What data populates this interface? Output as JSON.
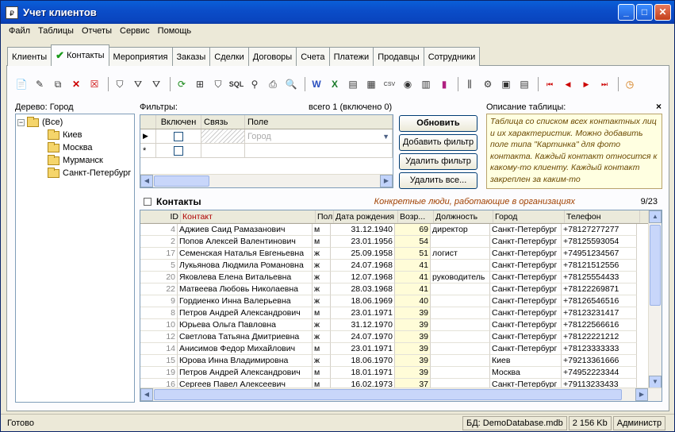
{
  "window": {
    "title": "Учет клиентов",
    "app_icon": "ledger-icon",
    "minimize": "_",
    "maximize": "□",
    "close": "✕"
  },
  "menu": [
    "Файл",
    "Таблицы",
    "Отчеты",
    "Сервис",
    "Помощь"
  ],
  "tabs": [
    {
      "label": "Клиенты"
    },
    {
      "label": "Контакты",
      "active": true
    },
    {
      "label": "Мероприятия"
    },
    {
      "label": "Заказы"
    },
    {
      "label": "Сделки"
    },
    {
      "label": "Договоры"
    },
    {
      "label": "Счета"
    },
    {
      "label": "Платежи"
    },
    {
      "label": "Продавцы"
    },
    {
      "label": "Сотрудники"
    }
  ],
  "tree": {
    "label": "Дерево: Город",
    "root": "(Все)",
    "items": [
      "Киев",
      "Москва",
      "Мурманск",
      "Санкт-Петербург"
    ]
  },
  "filters": {
    "label": "Фильтры:",
    "total": "всего 1 (включено 0)",
    "columns": [
      "Включен",
      "Связь",
      "Поле"
    ],
    "row_placeholder": "Город",
    "new_row_marker": "*"
  },
  "buttons": {
    "refresh": "Обновить",
    "add_filter": "Добавить фильтр",
    "remove_filter": "Удалить фильтр",
    "remove_all": "Удалить все..."
  },
  "description": {
    "label": "Описание таблицы:",
    "close": "×",
    "text": "Таблица со списком всех контактных лиц и их характеристик. Можно добавить поле типа \"Картинка\" для фото контакта. Каждый контакт относится к какому-то клиенту. Каждый контакт закреплен за каким-то"
  },
  "grid": {
    "title": "Контакты",
    "subtitle": "Конкретные люди, работающие в организациях",
    "counter": "9/23",
    "columns": [
      "ID",
      "Контакт",
      "Пол",
      "Дата рождения",
      "Возр...",
      "Должность",
      "Город",
      "Телефон"
    ],
    "rows": [
      [
        "4",
        "Аджиев Саид Рамазанович",
        "м",
        "31.12.1940",
        "69",
        "директор",
        "Санкт-Петербург",
        "+78127277277"
      ],
      [
        "2",
        "Попов Алексей Валентинович",
        "м",
        "23.01.1956",
        "54",
        "",
        "Санкт-Петербург",
        "+78125593054"
      ],
      [
        "17",
        "Семенская Наталья Евгеньевна",
        "ж",
        "25.09.1958",
        "51",
        "логист",
        "Санкт-Петербург",
        "+74951234567"
      ],
      [
        "5",
        "Лукьянова Людмила Романовна",
        "ж",
        "24.07.1968",
        "41",
        "",
        "Санкт-Петербург",
        "+78121512556"
      ],
      [
        "20",
        "Яковлева Елена Витальевна",
        "ж",
        "12.07.1968",
        "41",
        "руководитель",
        "Санкт-Петербург",
        "+78125554433"
      ],
      [
        "22",
        "Матвеева Любовь Николаевна",
        "ж",
        "28.03.1968",
        "41",
        "",
        "Санкт-Петербург",
        "+78122269871"
      ],
      [
        "9",
        "Гордиенко Инна Валерьевна",
        "ж",
        "18.06.1969",
        "40",
        "",
        "Санкт-Петербург",
        "+78126546516"
      ],
      [
        "8",
        "Петров Андрей Александрович",
        "м",
        "23.01.1971",
        "39",
        "",
        "Санкт-Петербург",
        "+78123231417"
      ],
      [
        "10",
        "Юрьева Ольга Павловна",
        "ж",
        "31.12.1970",
        "39",
        "",
        "Санкт-Петербург",
        "+78122566616"
      ],
      [
        "12",
        "Светлова Татьяна Дмитриевна",
        "ж",
        "24.07.1970",
        "39",
        "",
        "Санкт-Петербург",
        "+78122221212"
      ],
      [
        "14",
        "Анисимов Федор Михайлович",
        "м",
        "23.01.1971",
        "39",
        "",
        "Санкт-Петербург",
        "+78123333333"
      ],
      [
        "15",
        "Юрова Инна Владимировна",
        "ж",
        "18.06.1970",
        "39",
        "",
        "Киев",
        "+79213361666"
      ],
      [
        "19",
        "Петров Андрей Александрович",
        "м",
        "18.01.1971",
        "39",
        "",
        "Москва",
        "+74952223344"
      ],
      [
        "16",
        "Сергеев Павел Алексеевич",
        "м",
        "16.02.1973",
        "37",
        "",
        "Санкт-Петербург",
        "+79113233433"
      ]
    ]
  },
  "status": {
    "left": "Готово",
    "db_label": "БД:",
    "db": "DemoDatabase.mdb",
    "size": "2 156 Kb",
    "user": "Администр"
  }
}
